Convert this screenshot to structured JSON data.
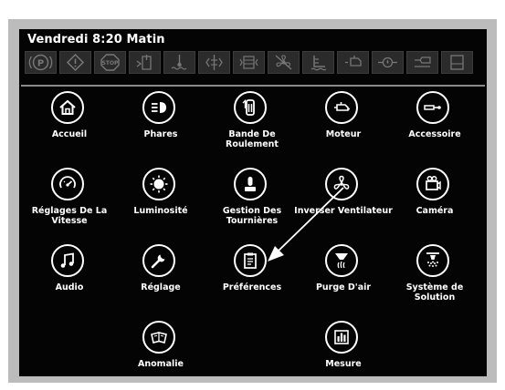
{
  "status": {
    "datetime": "Vendredi 8:20 Matin"
  },
  "warning_icons": [
    "parking-brake-icon",
    "caution-triangle-icon",
    "stop-icon",
    "hydraulic-oil-icon",
    "coolant-temperature-icon",
    "electrical-icon",
    "transmission-icon",
    "fan-warning-icon",
    "fluid-level-icon",
    "engine-warning-icon",
    "oil-pressure-icon",
    "fuel-filter-icon",
    "fuel-level-icon"
  ],
  "menu": {
    "items": [
      {
        "label": "Accueil",
        "icon": "home-icon"
      },
      {
        "label": "Phares",
        "icon": "headlights-icon"
      },
      {
        "label": "Bande De Roulement",
        "icon": "track-icon"
      },
      {
        "label": "Moteur",
        "icon": "engine-icon"
      },
      {
        "label": "Accessoire",
        "icon": "accessory-icon"
      },
      {
        "label": "Réglages De La Vitesse",
        "icon": "speedometer-icon"
      },
      {
        "label": "Luminosité",
        "icon": "brightness-icon"
      },
      {
        "label": "Gestion Des Tournières",
        "icon": "joystick-icon"
      },
      {
        "label": "Inverser Ventilateur",
        "icon": "fan-icon"
      },
      {
        "label": "Caméra",
        "icon": "camera-icon"
      },
      {
        "label": "Audio",
        "icon": "music-icon"
      },
      {
        "label": "Réglage",
        "icon": "wrench-icon"
      },
      {
        "label": "Préférences",
        "icon": "clipboard-icon"
      },
      {
        "label": "Purge D'air",
        "icon": "air-purge-icon"
      },
      {
        "label": "Système de Solution",
        "icon": "solution-system-icon"
      },
      {
        "label": "Anomalie",
        "icon": "manual-book-icon"
      },
      {
        "label": "Mesure",
        "icon": "bar-chart-icon"
      }
    ]
  },
  "colors": {
    "screen_background": "#040404",
    "frame": "#bcbcbc",
    "warning_box": "#2b2b2b",
    "icon_stroke": "#ffffff"
  }
}
